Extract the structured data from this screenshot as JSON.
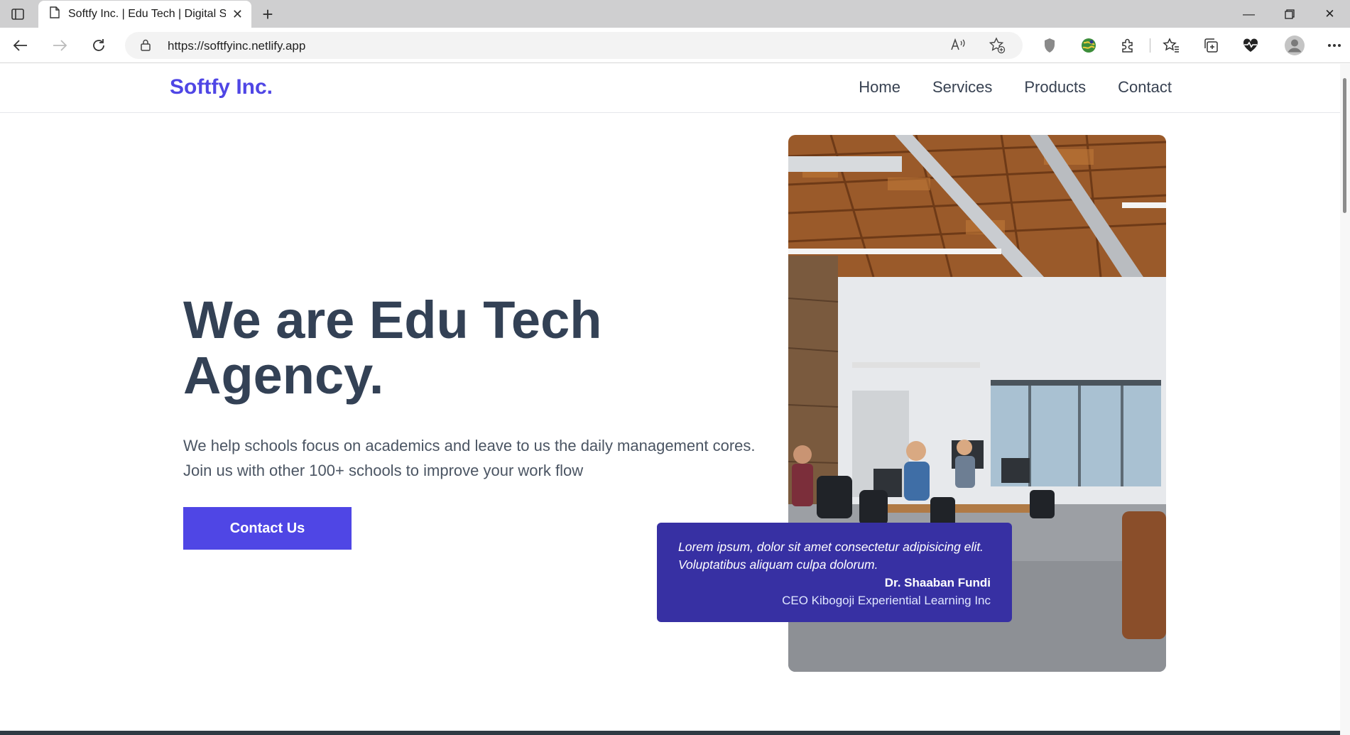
{
  "browser": {
    "tab_title": "Softfy Inc. | Edu Tech | Digital Sol",
    "url": "https://softfyinc.netlify.app",
    "read_aloud_label": "A\t"
  },
  "site": {
    "logo": "Softfy Inc.",
    "nav": [
      {
        "label": "Home"
      },
      {
        "label": "Services"
      },
      {
        "label": "Products"
      },
      {
        "label": "Contact"
      }
    ]
  },
  "hero": {
    "title_line1": "We are Edu Tech",
    "title_line2": "Agency.",
    "subtitle_line1": "We help schools focus on academics and leave to us the daily management cores.",
    "subtitle_line2": "Join us with other 100+ schools to improve your work flow",
    "cta_label": "Contact Us"
  },
  "testimonial": {
    "quote_line1": "Lorem ipsum, dolor sit amet consectetur adipisicing elit.",
    "quote_line2": "Voluptatibus aliquam culpa dolorum.",
    "name": "Dr. Shaaban Fundi",
    "role": "CEO Kibogoji Experiential Learning Inc"
  },
  "colors": {
    "brand": "#4f46e5",
    "testimonial_bg": "#3730a3",
    "heading": "#334155"
  }
}
